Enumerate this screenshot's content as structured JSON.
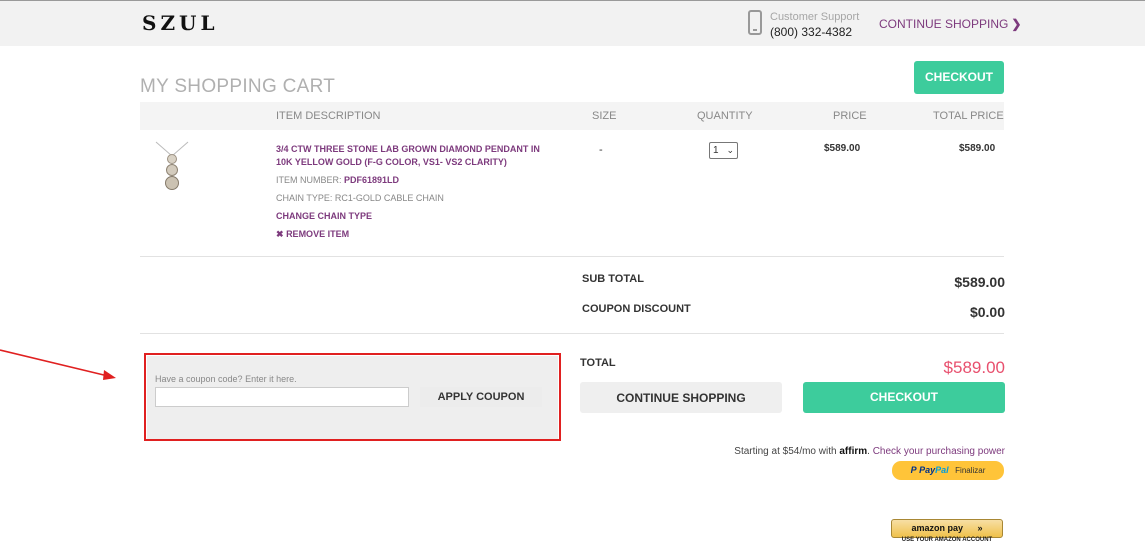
{
  "header": {
    "logo": "SZUL",
    "support_label": "Customer Support",
    "support_phone": "(800) 332-4382",
    "continue_shopping": "CONTINUE SHOPPING",
    "icon_phone": "phone-icon",
    "icon_chevron": "chevron-right-icon"
  },
  "cart": {
    "title": "MY SHOPPING CART",
    "checkout_label": "CHECKOUT",
    "columns": {
      "description": "ITEM DESCRIPTION",
      "size": "SIZE",
      "quantity": "QUANTITY",
      "price": "PRICE",
      "total_price": "TOTAL PRICE"
    },
    "items": [
      {
        "title": "3/4 CTW THREE STONE LAB GROWN DIAMOND PENDANT IN 10K YELLOW GOLD (F-G COLOR, VS1- VS2 CLARITY)",
        "item_number_label": "ITEM NUMBER:",
        "item_number": "PDF61891LD",
        "chain_type": "CHAIN TYPE: RC1-GOLD CABLE CHAIN",
        "change_chain": "CHANGE CHAIN TYPE",
        "remove": "REMOVE ITEM",
        "size": "-",
        "quantity": "1",
        "price": "$589.00",
        "total_price": "$589.00"
      }
    ]
  },
  "summary": {
    "subtotal_label": "SUB TOTAL",
    "subtotal": "$589.00",
    "coupon_discount_label": "COUPON DISCOUNT",
    "coupon_discount": "$0.00",
    "total_label": "TOTAL",
    "total": "$589.00"
  },
  "coupon": {
    "label": "Have a coupon code? Enter it here.",
    "placeholder": "",
    "value": "",
    "apply_label": "APPLY COUPON"
  },
  "actions": {
    "continue_shopping": "CONTINUE SHOPPING",
    "checkout": "CHECKOUT"
  },
  "affirm": {
    "prefix": "Starting at $54/mo with",
    "logo": "affirm",
    "link": "Check your purchasing power"
  },
  "paypal": {
    "pay": "Pay",
    "pal": "Pal",
    "suffix": "Finalizar",
    "letter": "P"
  },
  "amazon": {
    "label": "amazon pay",
    "chevrons": "»",
    "caption": "USE YOUR AMAZON ACCOUNT"
  },
  "colors": {
    "accent_green": "#3dcc9c",
    "link_purple": "#7d3a7d",
    "total_pink": "#e8506e",
    "annotation_red": "#e02020"
  }
}
